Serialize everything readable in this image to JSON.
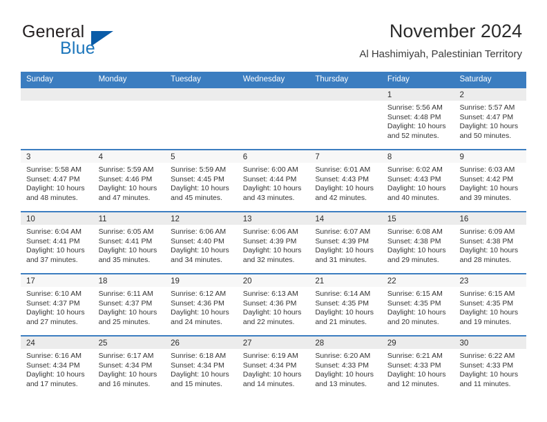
{
  "brand": {
    "name_part1": "General",
    "name_part2": "Blue",
    "logo_icon": "blue-triangle-flag-icon"
  },
  "header": {
    "title": "November 2024",
    "subtitle": "Al Hashimiyah, Palestinian Territory"
  },
  "theme": {
    "header_blue": "#3b7dc0",
    "brand_blue": "#1b75bb",
    "row_shade": "#ececec",
    "text": "#333333"
  },
  "calendar": {
    "weekday_headers": [
      "Sunday",
      "Monday",
      "Tuesday",
      "Wednesday",
      "Thursday",
      "Friday",
      "Saturday"
    ],
    "labels": {
      "sunrise": "Sunrise:",
      "sunset": "Sunset:",
      "daylight": "Daylight:"
    },
    "weeks": [
      [
        {
          "day": "",
          "sunrise": "",
          "sunset": "",
          "daylight_line1": "",
          "daylight_line2": ""
        },
        {
          "day": "",
          "sunrise": "",
          "sunset": "",
          "daylight_line1": "",
          "daylight_line2": ""
        },
        {
          "day": "",
          "sunrise": "",
          "sunset": "",
          "daylight_line1": "",
          "daylight_line2": ""
        },
        {
          "day": "",
          "sunrise": "",
          "sunset": "",
          "daylight_line1": "",
          "daylight_line2": ""
        },
        {
          "day": "",
          "sunrise": "",
          "sunset": "",
          "daylight_line1": "",
          "daylight_line2": ""
        },
        {
          "day": "1",
          "sunrise": "Sunrise: 5:56 AM",
          "sunset": "Sunset: 4:48 PM",
          "daylight_line1": "Daylight: 10 hours",
          "daylight_line2": "and 52 minutes."
        },
        {
          "day": "2",
          "sunrise": "Sunrise: 5:57 AM",
          "sunset": "Sunset: 4:47 PM",
          "daylight_line1": "Daylight: 10 hours",
          "daylight_line2": "and 50 minutes."
        }
      ],
      [
        {
          "day": "3",
          "sunrise": "Sunrise: 5:58 AM",
          "sunset": "Sunset: 4:47 PM",
          "daylight_line1": "Daylight: 10 hours",
          "daylight_line2": "and 48 minutes."
        },
        {
          "day": "4",
          "sunrise": "Sunrise: 5:59 AM",
          "sunset": "Sunset: 4:46 PM",
          "daylight_line1": "Daylight: 10 hours",
          "daylight_line2": "and 47 minutes."
        },
        {
          "day": "5",
          "sunrise": "Sunrise: 5:59 AM",
          "sunset": "Sunset: 4:45 PM",
          "daylight_line1": "Daylight: 10 hours",
          "daylight_line2": "and 45 minutes."
        },
        {
          "day": "6",
          "sunrise": "Sunrise: 6:00 AM",
          "sunset": "Sunset: 4:44 PM",
          "daylight_line1": "Daylight: 10 hours",
          "daylight_line2": "and 43 minutes."
        },
        {
          "day": "7",
          "sunrise": "Sunrise: 6:01 AM",
          "sunset": "Sunset: 4:43 PM",
          "daylight_line1": "Daylight: 10 hours",
          "daylight_line2": "and 42 minutes."
        },
        {
          "day": "8",
          "sunrise": "Sunrise: 6:02 AM",
          "sunset": "Sunset: 4:43 PM",
          "daylight_line1": "Daylight: 10 hours",
          "daylight_line2": "and 40 minutes."
        },
        {
          "day": "9",
          "sunrise": "Sunrise: 6:03 AM",
          "sunset": "Sunset: 4:42 PM",
          "daylight_line1": "Daylight: 10 hours",
          "daylight_line2": "and 39 minutes."
        }
      ],
      [
        {
          "day": "10",
          "sunrise": "Sunrise: 6:04 AM",
          "sunset": "Sunset: 4:41 PM",
          "daylight_line1": "Daylight: 10 hours",
          "daylight_line2": "and 37 minutes."
        },
        {
          "day": "11",
          "sunrise": "Sunrise: 6:05 AM",
          "sunset": "Sunset: 4:41 PM",
          "daylight_line1": "Daylight: 10 hours",
          "daylight_line2": "and 35 minutes."
        },
        {
          "day": "12",
          "sunrise": "Sunrise: 6:06 AM",
          "sunset": "Sunset: 4:40 PM",
          "daylight_line1": "Daylight: 10 hours",
          "daylight_line2": "and 34 minutes."
        },
        {
          "day": "13",
          "sunrise": "Sunrise: 6:06 AM",
          "sunset": "Sunset: 4:39 PM",
          "daylight_line1": "Daylight: 10 hours",
          "daylight_line2": "and 32 minutes."
        },
        {
          "day": "14",
          "sunrise": "Sunrise: 6:07 AM",
          "sunset": "Sunset: 4:39 PM",
          "daylight_line1": "Daylight: 10 hours",
          "daylight_line2": "and 31 minutes."
        },
        {
          "day": "15",
          "sunrise": "Sunrise: 6:08 AM",
          "sunset": "Sunset: 4:38 PM",
          "daylight_line1": "Daylight: 10 hours",
          "daylight_line2": "and 29 minutes."
        },
        {
          "day": "16",
          "sunrise": "Sunrise: 6:09 AM",
          "sunset": "Sunset: 4:38 PM",
          "daylight_line1": "Daylight: 10 hours",
          "daylight_line2": "and 28 minutes."
        }
      ],
      [
        {
          "day": "17",
          "sunrise": "Sunrise: 6:10 AM",
          "sunset": "Sunset: 4:37 PM",
          "daylight_line1": "Daylight: 10 hours",
          "daylight_line2": "and 27 minutes."
        },
        {
          "day": "18",
          "sunrise": "Sunrise: 6:11 AM",
          "sunset": "Sunset: 4:37 PM",
          "daylight_line1": "Daylight: 10 hours",
          "daylight_line2": "and 25 minutes."
        },
        {
          "day": "19",
          "sunrise": "Sunrise: 6:12 AM",
          "sunset": "Sunset: 4:36 PM",
          "daylight_line1": "Daylight: 10 hours",
          "daylight_line2": "and 24 minutes."
        },
        {
          "day": "20",
          "sunrise": "Sunrise: 6:13 AM",
          "sunset": "Sunset: 4:36 PM",
          "daylight_line1": "Daylight: 10 hours",
          "daylight_line2": "and 22 minutes."
        },
        {
          "day": "21",
          "sunrise": "Sunrise: 6:14 AM",
          "sunset": "Sunset: 4:35 PM",
          "daylight_line1": "Daylight: 10 hours",
          "daylight_line2": "and 21 minutes."
        },
        {
          "day": "22",
          "sunrise": "Sunrise: 6:15 AM",
          "sunset": "Sunset: 4:35 PM",
          "daylight_line1": "Daylight: 10 hours",
          "daylight_line2": "and 20 minutes."
        },
        {
          "day": "23",
          "sunrise": "Sunrise: 6:15 AM",
          "sunset": "Sunset: 4:35 PM",
          "daylight_line1": "Daylight: 10 hours",
          "daylight_line2": "and 19 minutes."
        }
      ],
      [
        {
          "day": "24",
          "sunrise": "Sunrise: 6:16 AM",
          "sunset": "Sunset: 4:34 PM",
          "daylight_line1": "Daylight: 10 hours",
          "daylight_line2": "and 17 minutes."
        },
        {
          "day": "25",
          "sunrise": "Sunrise: 6:17 AM",
          "sunset": "Sunset: 4:34 PM",
          "daylight_line1": "Daylight: 10 hours",
          "daylight_line2": "and 16 minutes."
        },
        {
          "day": "26",
          "sunrise": "Sunrise: 6:18 AM",
          "sunset": "Sunset: 4:34 PM",
          "daylight_line1": "Daylight: 10 hours",
          "daylight_line2": "and 15 minutes."
        },
        {
          "day": "27",
          "sunrise": "Sunrise: 6:19 AM",
          "sunset": "Sunset: 4:34 PM",
          "daylight_line1": "Daylight: 10 hours",
          "daylight_line2": "and 14 minutes."
        },
        {
          "day": "28",
          "sunrise": "Sunrise: 6:20 AM",
          "sunset": "Sunset: 4:33 PM",
          "daylight_line1": "Daylight: 10 hours",
          "daylight_line2": "and 13 minutes."
        },
        {
          "day": "29",
          "sunrise": "Sunrise: 6:21 AM",
          "sunset": "Sunset: 4:33 PM",
          "daylight_line1": "Daylight: 10 hours",
          "daylight_line2": "and 12 minutes."
        },
        {
          "day": "30",
          "sunrise": "Sunrise: 6:22 AM",
          "sunset": "Sunset: 4:33 PM",
          "daylight_line1": "Daylight: 10 hours",
          "daylight_line2": "and 11 minutes."
        }
      ]
    ]
  }
}
